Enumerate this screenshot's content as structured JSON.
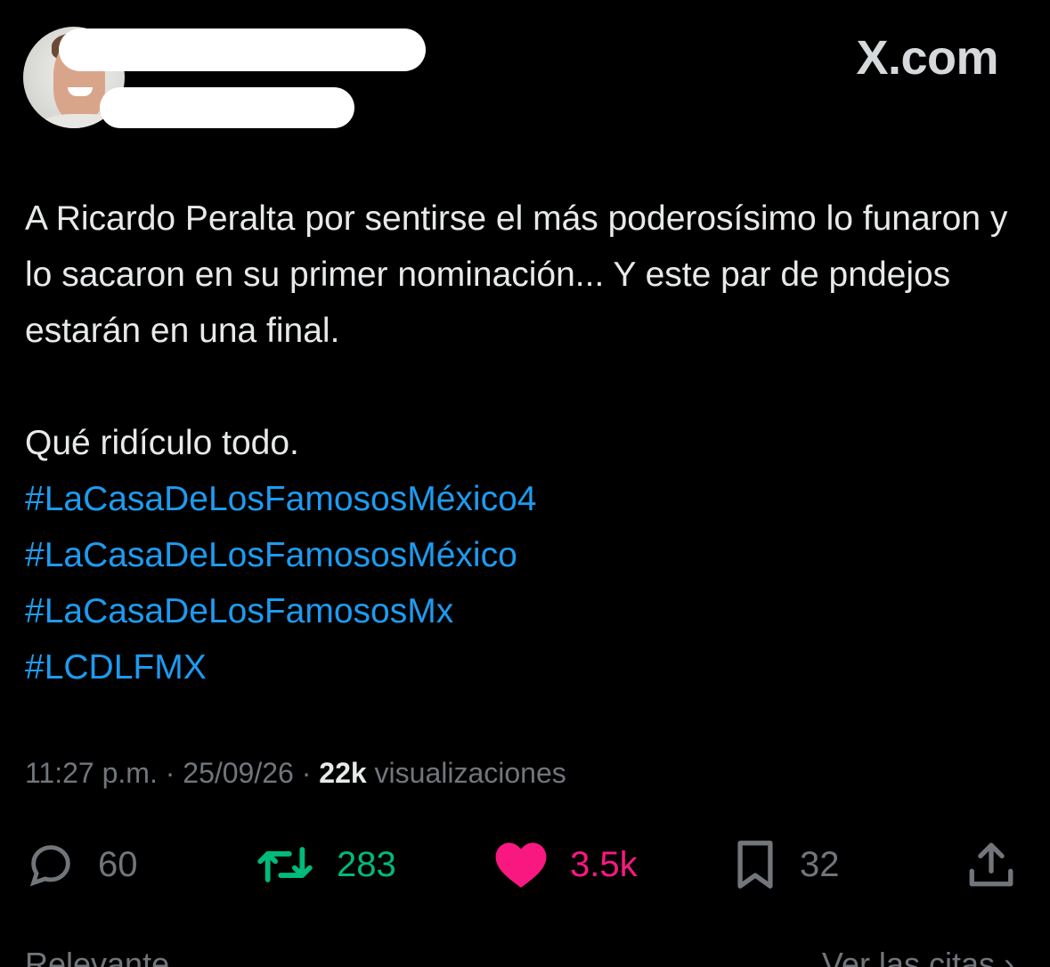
{
  "header": {
    "brand": "X.com",
    "name_redacted": true,
    "handle_redacted": true
  },
  "tweet": {
    "paragraph_1": "A Ricardo Peralta por sentirse el más poderosísimo lo funaron y lo sacaron en su primer nominación... Y este par de pndejos estarán en una final.",
    "paragraph_2": "Qué ridículo todo.",
    "hashtags": [
      "#LaCasaDeLosFamososMéxico4",
      "#LaCasaDeLosFamososMéxico",
      "#LaCasaDeLosFamososMx",
      "#LCDLFMX"
    ]
  },
  "meta": {
    "time": "11:27 p.m.",
    "separator": " · ",
    "date": "25/09/26",
    "views_count": "22k",
    "views_label": "visualizaciones"
  },
  "actions": {
    "replies": "60",
    "retweets": "283",
    "likes": "3.5k",
    "bookmarks": "32"
  },
  "colors": {
    "link": "#1d9bf0",
    "retweet": "#00ba7c",
    "like": "#f91880",
    "muted": "#71767b"
  },
  "icons": [
    "reply-icon",
    "retweet-icon",
    "heart-icon",
    "bookmark-icon",
    "share-icon"
  ],
  "footer": {
    "sort_label": "Relevante",
    "quotes_label": "Ver las citas"
  }
}
